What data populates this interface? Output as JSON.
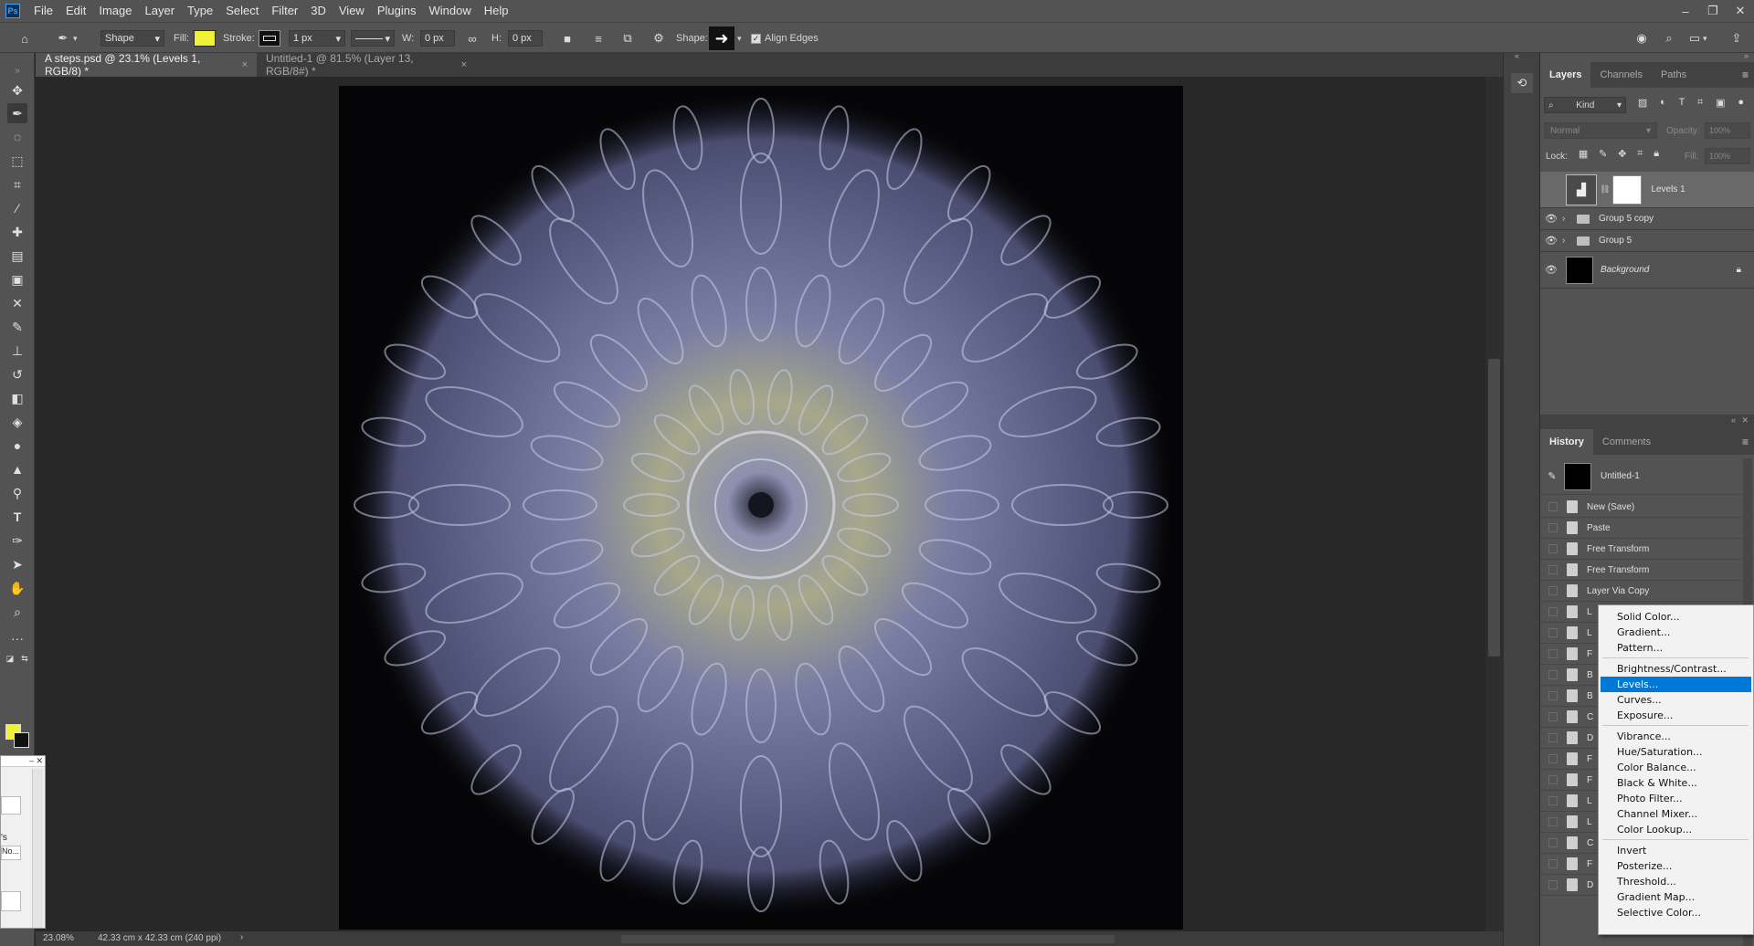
{
  "app": {
    "logo": "Ps"
  },
  "menubar": [
    "File",
    "Edit",
    "Image",
    "Layer",
    "Type",
    "Select",
    "Filter",
    "3D",
    "View",
    "Plugins",
    "Window",
    "Help"
  ],
  "window_controls": [
    "–",
    "❐",
    "✕"
  ],
  "options": {
    "mode": "Shape",
    "fill_label": "Fill:",
    "stroke_label": "Stroke:",
    "stroke_width": "1 px",
    "w_label": "W:",
    "w_value": "0 px",
    "h_label": "H:",
    "h_value": "0 px",
    "shape_label": "Shape:",
    "align_edges": "Align Edges",
    "fill_color": "#f0f03a"
  },
  "tabs": [
    {
      "label": "A steps.psd @ 23.1% (Levels 1, RGB/8) *",
      "close": "×"
    },
    {
      "label": "Untitled-1 @ 81.5% (Layer 13, RGB/8#) *",
      "close": "×"
    }
  ],
  "status": {
    "zoom": "23.08%",
    "size": "42.33 cm x 42.33 cm (240 ppi)",
    "arrow": "›"
  },
  "floating_panel": {
    "text1": "'s",
    "text2": "No..."
  },
  "layers_panel": {
    "tabs": [
      "Layers",
      "Channels",
      "Paths"
    ],
    "filter": "Kind",
    "blend_mode": "Normal",
    "opacity_label": "Opacity:",
    "opacity_value": "100%",
    "lock_label": "Lock:",
    "fill_label": "Fill:",
    "fill_value": "100%",
    "layers": [
      {
        "name": "Levels 1"
      },
      {
        "name": "Group 5 copy"
      },
      {
        "name": "Group 5"
      },
      {
        "name": "Background"
      }
    ]
  },
  "history_panel": {
    "tabs": [
      "History",
      "Comments"
    ],
    "snapshot": "Untitled-1",
    "items": [
      "New (Save)",
      "Paste",
      "Free Transform",
      "Free Transform",
      "Layer Via Copy",
      "L",
      "L",
      "F",
      "B",
      "B",
      "C",
      "D",
      "F",
      "F",
      "L",
      "L",
      "C",
      "F",
      "D"
    ]
  },
  "context_menu": {
    "groups": [
      [
        "Solid Color...",
        "Gradient...",
        "Pattern..."
      ],
      [
        "Brightness/Contrast...",
        "Levels...",
        "Curves...",
        "Exposure..."
      ],
      [
        "Vibrance...",
        "Hue/Saturation...",
        "Color Balance...",
        "Black & White...",
        "Photo Filter...",
        "Channel Mixer...",
        "Color Lookup..."
      ],
      [
        "Invert",
        "Posterize...",
        "Threshold...",
        "Gradient Map...",
        "Selective Color..."
      ]
    ],
    "highlighted": "Levels..."
  }
}
